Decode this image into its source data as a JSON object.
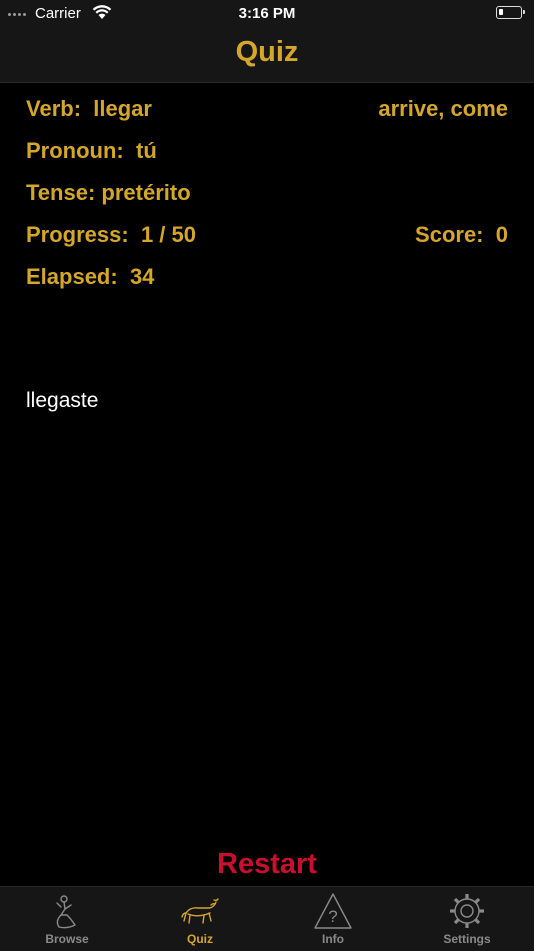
{
  "status": {
    "carrier": "Carrier",
    "time": "3:16 PM"
  },
  "nav": {
    "title": "Quiz"
  },
  "quiz": {
    "verb_label": "Verb:",
    "verb": "llegar",
    "meaning": "arrive, come",
    "pronoun_label": "Pronoun:",
    "pronoun": "tú",
    "tense_label": "Tense:",
    "tense": "pretérito",
    "progress_label": "Progress:",
    "progress": "1 / 50",
    "score_label": "Score:",
    "score": "0",
    "elapsed_label": "Elapsed:",
    "elapsed": "34",
    "answer": "llegaste"
  },
  "restart_label": "Restart",
  "tabs": [
    {
      "label": "Browse",
      "icon": "dancer-icon",
      "active": false
    },
    {
      "label": "Quiz",
      "icon": "bull-icon",
      "active": true
    },
    {
      "label": "Info",
      "icon": "question-triangle-icon",
      "active": false
    },
    {
      "label": "Settings",
      "icon": "gear-icon",
      "active": false
    }
  ],
  "colors": {
    "accent": "#d4a62a",
    "restart": "#c8102e",
    "inactive_tab": "#8a8a8a"
  }
}
